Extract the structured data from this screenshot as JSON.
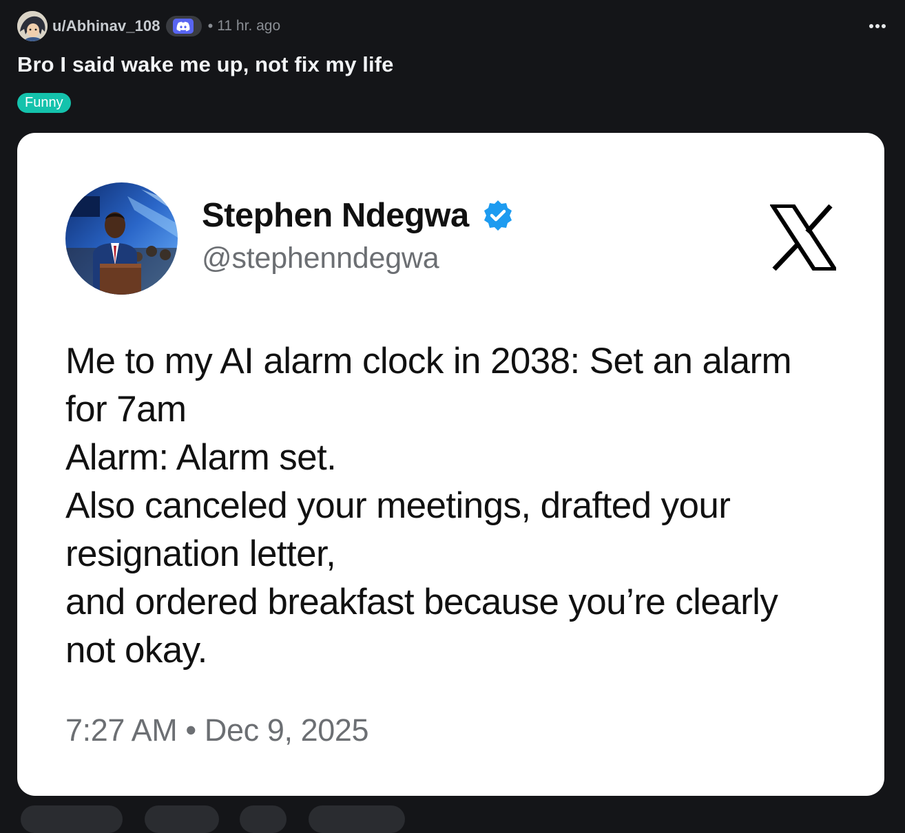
{
  "post": {
    "username": "u/Abhinav_108",
    "separator": "•",
    "time_ago": "11 hr. ago",
    "title": "Bro I said wake me up, not fix my life",
    "flair": "Funny",
    "more_icon": "more-horizontal-icon",
    "user_flair_icon": "discord-icon"
  },
  "tweet": {
    "name": "Stephen Ndegwa",
    "handle": "@stephenndegwa",
    "verified_icon": "verified-badge-icon",
    "platform_icon": "x-logo-icon",
    "lines": [
      "Me to my AI alarm clock in 2038: Set an alarm",
      "for 7am",
      "Alarm: Alarm set.",
      "Also canceled your meetings, drafted your",
      "resignation letter,",
      "and ordered breakfast because you’re clearly",
      "not okay."
    ],
    "time": "7:27 AM",
    "meta_separator": "•",
    "date": "Dec 9, 2025"
  },
  "colors": {
    "background": "#141518",
    "flair": "#14c2ac",
    "verified": "#1d9bf0",
    "discord": "#5865f2"
  }
}
